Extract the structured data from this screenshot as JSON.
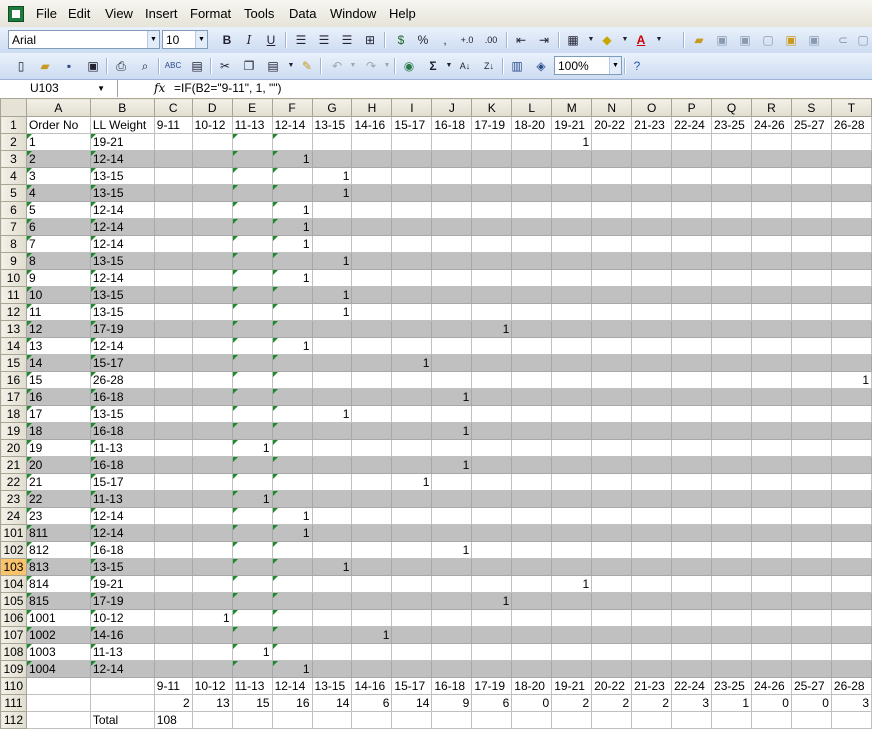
{
  "menu": [
    "File",
    "Edit",
    "View",
    "Insert",
    "Format",
    "Tools",
    "Data",
    "Window",
    "Help"
  ],
  "toolbar": {
    "font_name": "Arial",
    "font_size": "10",
    "bold": "B",
    "italic": "I",
    "underline": "U",
    "percent": "%",
    "comma": ",",
    "zoom": "100%",
    "sigma": "Σ"
  },
  "formula_bar": {
    "name_box": "U103",
    "fx": "fx",
    "formula": "=IF(B2=\"9-11\", 1, \"\")"
  },
  "grid": {
    "columns": [
      "A",
      "B",
      "C",
      "D",
      "E",
      "F",
      "G",
      "H",
      "I",
      "J",
      "K",
      "L",
      "M",
      "N",
      "O",
      "P",
      "Q",
      "R",
      "S",
      "T"
    ],
    "header_row": {
      "row": "1",
      "cells": [
        "Order No",
        "LL Weight",
        "9-11",
        "10-12",
        "11-13",
        "12-14",
        "13-15",
        "14-16",
        "15-17",
        "16-18",
        "17-19",
        "18-20",
        "19-21",
        "20-22",
        "21-23",
        "22-24",
        "23-25",
        "24-26",
        "25-27",
        "26-28"
      ]
    },
    "rows": [
      {
        "row": "2",
        "order": "1",
        "weight": "19-21",
        "mark": "1",
        "shaded": false
      },
      {
        "row": "3",
        "order": "2",
        "weight": "12-14",
        "mark": "1",
        "shaded": true
      },
      {
        "row": "4",
        "order": "3",
        "weight": "13-15",
        "mark": "1",
        "shaded": false
      },
      {
        "row": "5",
        "order": "4",
        "weight": "13-15",
        "mark": "1",
        "shaded": true
      },
      {
        "row": "6",
        "order": "5",
        "weight": "12-14",
        "mark": "1",
        "shaded": false
      },
      {
        "row": "7",
        "order": "6",
        "weight": "12-14",
        "mark": "1",
        "shaded": true
      },
      {
        "row": "8",
        "order": "7",
        "weight": "12-14",
        "mark": "1",
        "shaded": false
      },
      {
        "row": "9",
        "order": "8",
        "weight": "13-15",
        "mark": "1",
        "shaded": true
      },
      {
        "row": "10",
        "order": "9",
        "weight": "12-14",
        "mark": "1",
        "shaded": false
      },
      {
        "row": "11",
        "order": "10",
        "weight": "13-15",
        "mark": "1",
        "shaded": true
      },
      {
        "row": "12",
        "order": "11",
        "weight": "13-15",
        "mark": "1",
        "shaded": false
      },
      {
        "row": "13",
        "order": "12",
        "weight": "17-19",
        "mark": "1",
        "shaded": true
      },
      {
        "row": "14",
        "order": "13",
        "weight": "12-14",
        "mark": "1",
        "shaded": false
      },
      {
        "row": "15",
        "order": "14",
        "weight": "15-17",
        "mark": "1",
        "shaded": true
      },
      {
        "row": "16",
        "order": "15",
        "weight": "26-28",
        "mark": "1",
        "shaded": false
      },
      {
        "row": "17",
        "order": "16",
        "weight": "16-18",
        "mark": "1",
        "shaded": true
      },
      {
        "row": "18",
        "order": "17",
        "weight": "13-15",
        "mark": "1",
        "shaded": false
      },
      {
        "row": "19",
        "order": "18",
        "weight": "16-18",
        "mark": "1",
        "shaded": true
      },
      {
        "row": "20",
        "order": "19",
        "weight": "11-13",
        "mark": "1",
        "shaded": false
      },
      {
        "row": "21",
        "order": "20",
        "weight": "16-18",
        "mark": "1",
        "shaded": true
      },
      {
        "row": "22",
        "order": "21",
        "weight": "15-17",
        "mark": "1",
        "shaded": false
      },
      {
        "row": "23",
        "order": "22",
        "weight": "11-13",
        "mark": "1",
        "shaded": true
      },
      {
        "row": "24",
        "order": "23",
        "weight": "12-14",
        "mark": "1",
        "shaded": false
      },
      {
        "row": "101",
        "order": "811",
        "weight": "12-14",
        "mark": "1",
        "shaded": true
      },
      {
        "row": "102",
        "order": "812",
        "weight": "16-18",
        "mark": "1",
        "shaded": false
      },
      {
        "row": "103",
        "order": "813",
        "weight": "13-15",
        "mark": "1",
        "shaded": true
      },
      {
        "row": "104",
        "order": "814",
        "weight": "19-21",
        "mark": "1",
        "shaded": false
      },
      {
        "row": "105",
        "order": "815",
        "weight": "17-19",
        "mark": "1",
        "shaded": true
      },
      {
        "row": "106",
        "order": "1001",
        "weight": "10-12",
        "mark": "1",
        "shaded": false
      },
      {
        "row": "107",
        "order": "1002",
        "weight": "14-16",
        "mark": "1",
        "shaded": true
      },
      {
        "row": "108",
        "order": "1003",
        "weight": "11-13",
        "mark": "1",
        "shaded": false
      },
      {
        "row": "109",
        "order": "1004",
        "weight": "12-14",
        "mark": "1",
        "shaded": true
      }
    ],
    "labels_row": {
      "row": "110",
      "cells": [
        "9-11",
        "10-12",
        "11-13",
        "12-14",
        "13-15",
        "14-16",
        "15-17",
        "16-18",
        "17-19",
        "18-20",
        "19-21",
        "20-22",
        "21-23",
        "22-24",
        "23-25",
        "24-26",
        "25-27",
        "26-28"
      ]
    },
    "counts_row": {
      "row": "111",
      "cells": [
        "2",
        "13",
        "15",
        "16",
        "14",
        "6",
        "14",
        "9",
        "6",
        "0",
        "2",
        "2",
        "2",
        "3",
        "1",
        "0",
        "0",
        "3"
      ]
    },
    "total_row": {
      "row": "112",
      "label": "Total",
      "value": "108"
    },
    "active_row": "103"
  }
}
